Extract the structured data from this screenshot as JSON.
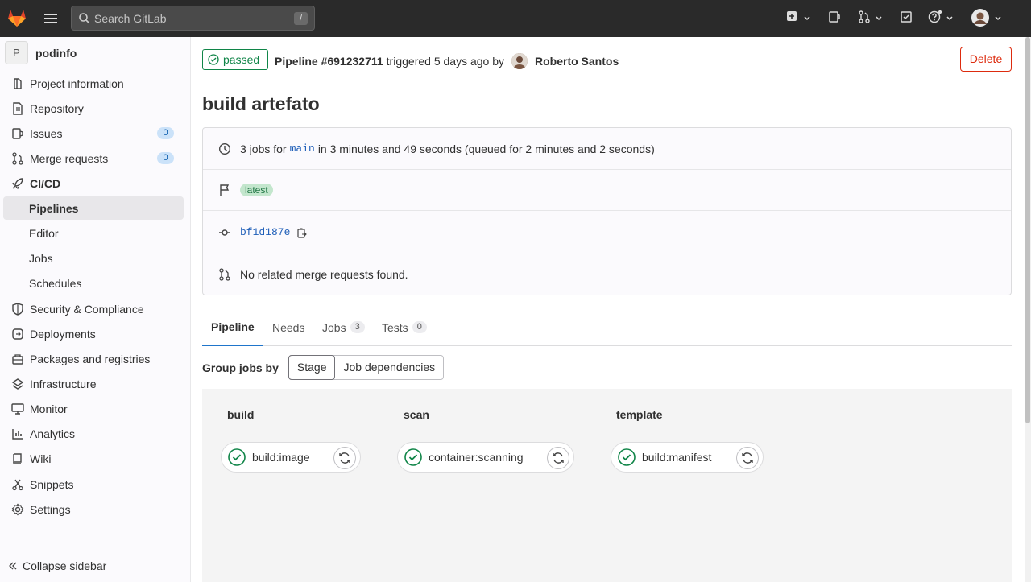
{
  "colors": {
    "success": "#108548",
    "danger": "#dd2b0e",
    "link": "#1f5fb8",
    "navbar": "#2a2a2a"
  },
  "navbar": {
    "search_placeholder": "Search GitLab",
    "search_shortcut": "/",
    "icons": [
      "gitlab-logo",
      "menu-icon",
      "search-icon",
      "plus-square-icon",
      "issues-icon",
      "merge-request-icon",
      "todo-icon",
      "help-icon",
      "user-avatar"
    ]
  },
  "sidebar": {
    "project_initial": "P",
    "project_name": "podinfo",
    "items": [
      {
        "label": "Project information",
        "icon": "project-icon"
      },
      {
        "label": "Repository",
        "icon": "doc-icon"
      },
      {
        "label": "Issues",
        "icon": "issues-icon",
        "count": "0"
      },
      {
        "label": "Merge requests",
        "icon": "merge-request-icon",
        "count": "0"
      },
      {
        "label": "CI/CD",
        "icon": "rocket-icon"
      },
      {
        "label": "Pipelines"
      },
      {
        "label": "Editor"
      },
      {
        "label": "Jobs"
      },
      {
        "label": "Schedules"
      },
      {
        "label": "Security & Compliance",
        "icon": "shield-icon"
      },
      {
        "label": "Deployments",
        "icon": "deployments-icon"
      },
      {
        "label": "Packages and registries",
        "icon": "package-icon"
      },
      {
        "label": "Infrastructure",
        "icon": "cloud-icon"
      },
      {
        "label": "Monitor",
        "icon": "monitor-icon"
      },
      {
        "label": "Analytics",
        "icon": "chart-icon"
      },
      {
        "label": "Wiki",
        "icon": "book-icon"
      },
      {
        "label": "Snippets",
        "icon": "scissors-icon"
      },
      {
        "label": "Settings",
        "icon": "gear-icon"
      }
    ],
    "collapse_label": "Collapse sidebar"
  },
  "header": {
    "status": "passed",
    "pipeline_label": "Pipeline #691232711",
    "triggered_text": "triggered 5 days ago by",
    "user": "Roberto Santos",
    "delete_label": "Delete"
  },
  "title": "build artefato",
  "info": {
    "jobs_prefix": "3 jobs for",
    "branch": "main",
    "jobs_suffix": "in 3 minutes and 49 seconds (queued for 2 minutes and 2 seconds)",
    "tag": "latest",
    "commit": "bf1d187e",
    "mr_text": "No related merge requests found."
  },
  "tabs": [
    {
      "label": "Pipeline"
    },
    {
      "label": "Needs"
    },
    {
      "label": "Jobs",
      "count": "3"
    },
    {
      "label": "Tests",
      "count": "0"
    }
  ],
  "group_by": {
    "label": "Group jobs by",
    "options": [
      "Stage",
      "Job dependencies"
    ],
    "selected": "Stage"
  },
  "stages": [
    {
      "name": "build",
      "job": "build:image"
    },
    {
      "name": "scan",
      "job": "container:scanning"
    },
    {
      "name": "template",
      "job": "build:manifest"
    }
  ]
}
